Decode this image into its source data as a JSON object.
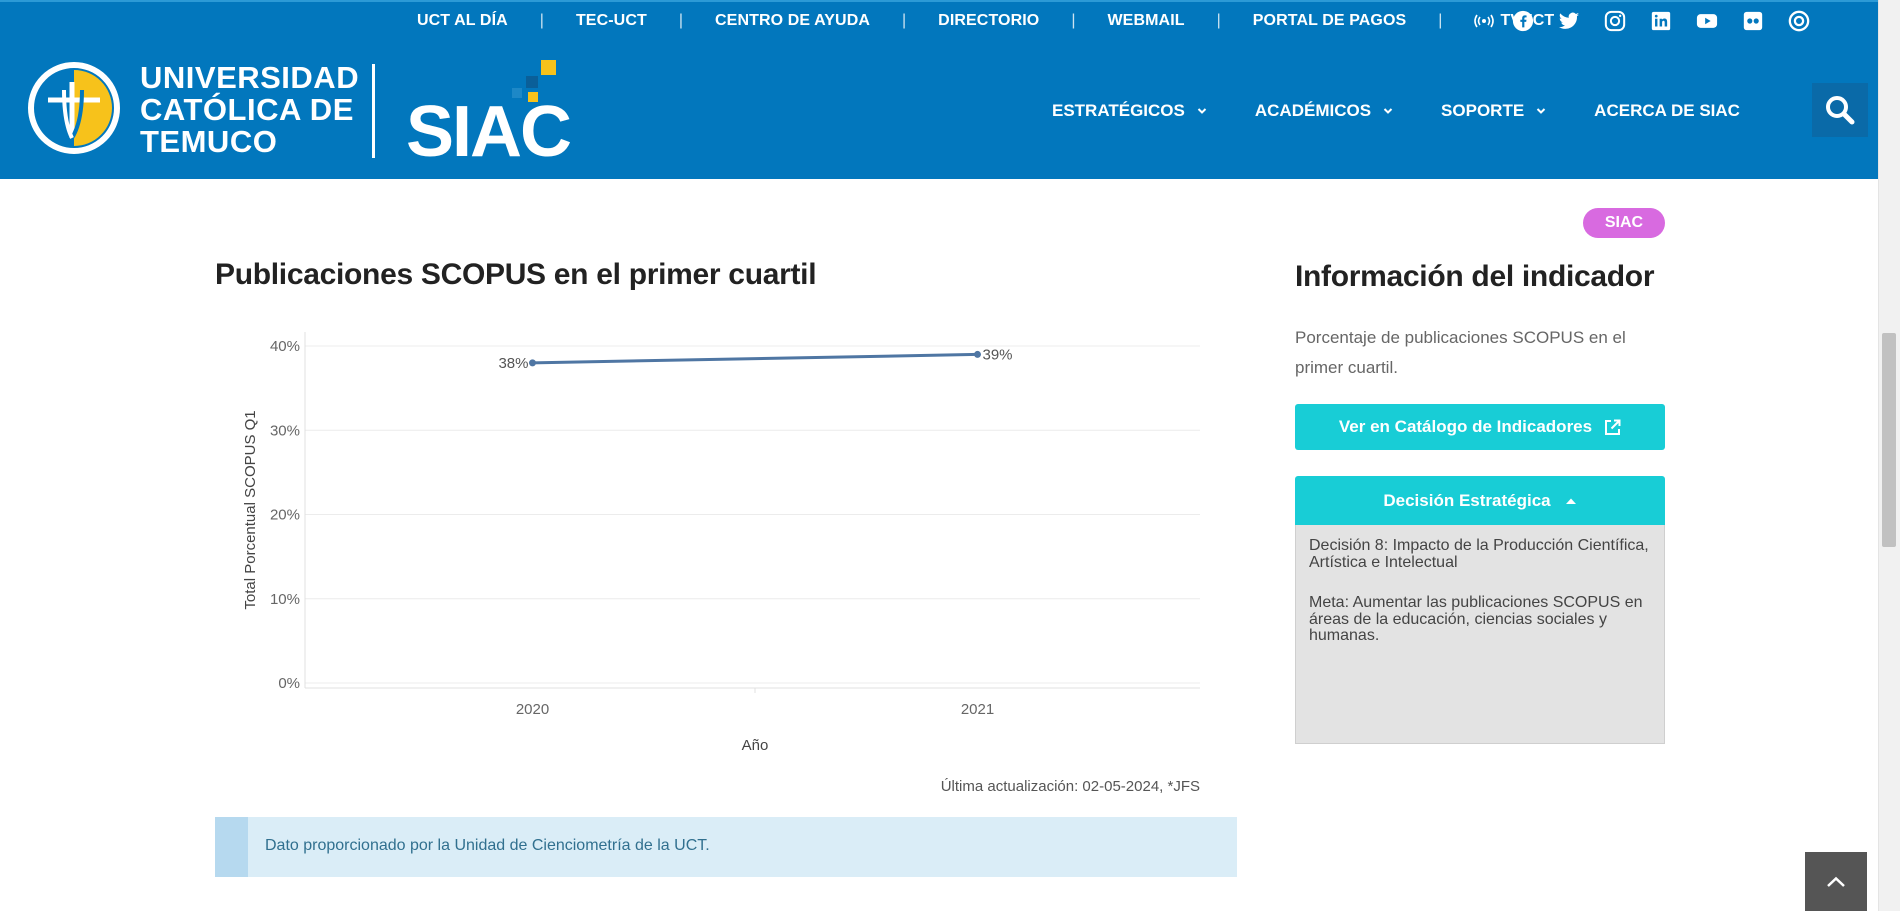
{
  "topnav": {
    "items": [
      "UCT AL DÍA",
      "TEC-UCT",
      "CENTRO DE AYUDA",
      "DIRECTORIO",
      "WEBMAIL",
      "PORTAL DE PAGOS"
    ],
    "tvuct": "TVUCT"
  },
  "socials": [
    "facebook-icon",
    "twitter-icon",
    "instagram-icon",
    "linkedin-icon",
    "youtube-icon",
    "flickr-icon",
    "issuu-icon"
  ],
  "brand": {
    "line1": "UNIVERSIDAD",
    "line2": "CATÓLICA DE",
    "line3": "TEMUCO",
    "siac": "SIAC"
  },
  "mainnav": {
    "items": [
      "ESTRATÉGICOS",
      "ACADÉMICOS",
      "SOPORTE",
      "ACERCA DE SIAC"
    ]
  },
  "badge": "SIAC",
  "chart": {
    "title": "Publicaciones SCOPUS en el primer cuartil",
    "updated": "Última actualización: 02-05-2024, *JFS"
  },
  "chart_data": {
    "type": "line",
    "title": "Publicaciones SCOPUS en el primer cuartil",
    "xlabel": "Año",
    "ylabel": "Total Porcentual SCOPUS Q1",
    "categories": [
      "2020",
      "2021"
    ],
    "values": [
      38,
      39
    ],
    "value_labels": [
      "38%",
      "39%"
    ],
    "ylim": [
      0,
      40
    ],
    "yticks": [
      "0%",
      "10%",
      "20%",
      "30%",
      "40%"
    ],
    "grid": true,
    "color": "#4f76a3"
  },
  "infobox": {
    "text": "Dato proporcionado por la Unidad de Cienciometría de la UCT."
  },
  "side": {
    "title": "Información del indicador",
    "description": "Porcentaje de publicaciones SCOPUS en el primer cuartil.",
    "catalog_button": "Ver en Catálogo de Indicadores",
    "decision_button": "Decisión Estratégica",
    "decision_text": "Decisión 8: Impacto de la Producción Científica, Artística e Intelectual",
    "meta_text": "Meta: Aumentar las publicaciones SCOPUS en áreas de la educación, ciencias sociales y humanas."
  },
  "colors": {
    "header": "#0277bd",
    "accent": "#18cdd6",
    "badge": "#d86ae0",
    "info_bg": "#daedf7"
  }
}
